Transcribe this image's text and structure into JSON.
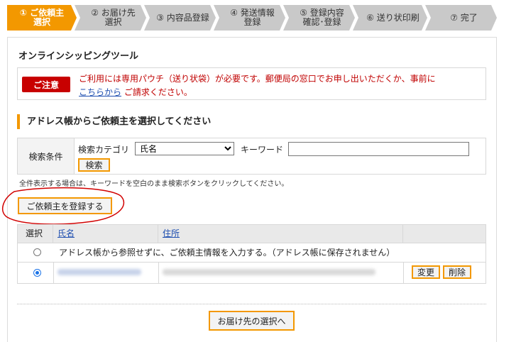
{
  "steps": [
    {
      "label": "① ご依頼主\n選択",
      "active": true
    },
    {
      "label": "② お届け先\n選択",
      "active": false
    },
    {
      "label": "③ 内容品登録",
      "active": false
    },
    {
      "label": "④ 発送情報\n登録",
      "active": false
    },
    {
      "label": "⑤ 登録内容\n確認･登録",
      "active": false
    },
    {
      "label": "⑥ 送り状印刷",
      "active": false
    },
    {
      "label": "⑦ 完了",
      "active": false
    }
  ],
  "tool_title": "オンラインシッピングツール",
  "notice": {
    "badge": "ご注意",
    "text_before": "ご利用には専用パウチ（送り状袋）が必要です。郵便局の窓口でお申し出いただくか、事前に",
    "link": "こちらから",
    "text_after": "ご請求ください。"
  },
  "section_title": "アドレス帳からご依頼主を選択してください",
  "search": {
    "conditions_label": "検索条件",
    "category_label": "検索カテゴリ",
    "category_selected": "氏名",
    "keyword_label": "キーワード",
    "keyword_value": "",
    "search_button": "検索"
  },
  "hint": "全件表示する場合は、キーワードを空白のまま検索ボタンをクリックしてください。",
  "register_button": "ご依頼主を登録する",
  "table": {
    "headers": [
      "選択",
      "氏名",
      "住所"
    ],
    "manual_row_text": "アドレス帳から参照せずに、ご依頼主情報を入力する。（アドレス帳に保存されません）",
    "edit_button": "変更",
    "delete_button": "削除"
  },
  "next_button": "お届け先の選択へ",
  "colors": {
    "accent": "#f39800",
    "notice_red": "#c80000",
    "link_blue": "#1f4fb0"
  }
}
